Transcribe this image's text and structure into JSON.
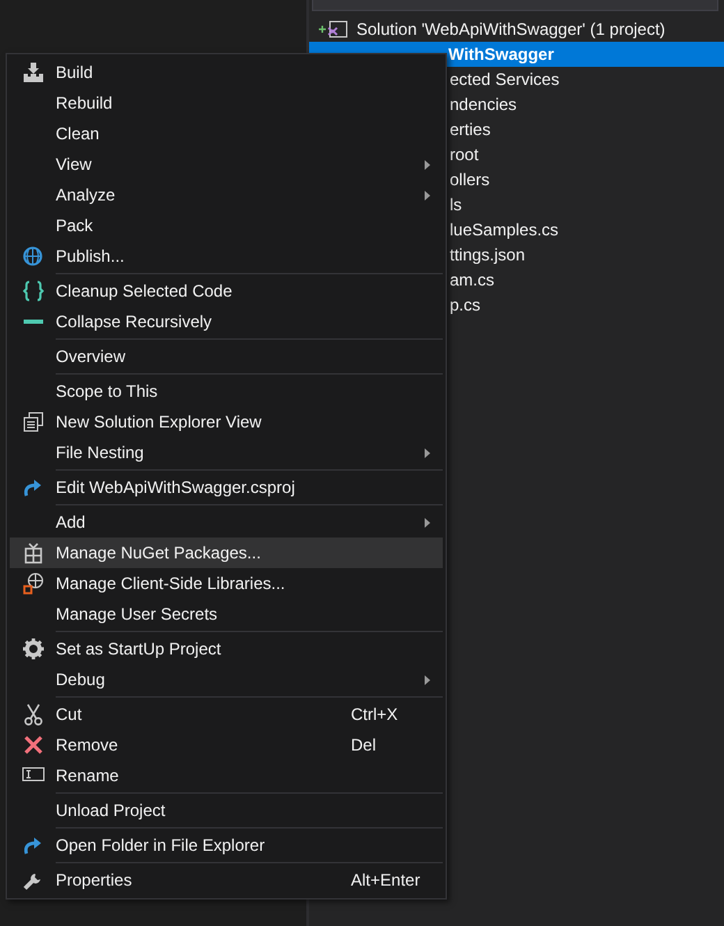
{
  "solution_explorer": {
    "tree": [
      {
        "label": "Solution 'WebApiWithSwagger' (1 project)",
        "kind": "solution",
        "selected": false
      },
      {
        "label": "WithSwagger",
        "kind": "project",
        "selected": true
      },
      {
        "label": "ected Services",
        "kind": "partial",
        "selected": false
      },
      {
        "label": "ndencies",
        "kind": "partial",
        "selected": false
      },
      {
        "label": "erties",
        "kind": "partial",
        "selected": false
      },
      {
        "label": "root",
        "kind": "partial",
        "selected": false
      },
      {
        "label": "ollers",
        "kind": "partial",
        "selected": false
      },
      {
        "label": "ls",
        "kind": "partial",
        "selected": false
      },
      {
        "label": "lueSamples.cs",
        "kind": "partial",
        "selected": false
      },
      {
        "label": "ttings.json",
        "kind": "partial",
        "selected": false
      },
      {
        "label": "am.cs",
        "kind": "partial",
        "selected": false
      },
      {
        "label": "p.cs",
        "kind": "partial",
        "selected": false
      }
    ]
  },
  "context_menu": {
    "groups": [
      [
        {
          "label": "Build",
          "kind": "build",
          "submenu": false,
          "selected": false
        },
        {
          "label": "Rebuild",
          "kind": "plain",
          "submenu": false,
          "selected": false
        },
        {
          "label": "Clean",
          "kind": "plain",
          "submenu": false,
          "selected": false
        },
        {
          "label": "View",
          "kind": "plain",
          "submenu": true,
          "selected": false
        },
        {
          "label": "Analyze",
          "kind": "plain",
          "submenu": true,
          "selected": false
        },
        {
          "label": "Pack",
          "kind": "plain",
          "submenu": false,
          "selected": false
        },
        {
          "label": "Publish...",
          "kind": "publish",
          "submenu": false,
          "selected": false
        }
      ],
      [
        {
          "label": "Cleanup Selected Code",
          "kind": "cleanup",
          "submenu": false,
          "selected": false
        },
        {
          "label": "Collapse Recursively",
          "kind": "collapse",
          "submenu": false,
          "selected": false
        }
      ],
      [
        {
          "label": "Overview",
          "kind": "plain",
          "submenu": false,
          "selected": false
        }
      ],
      [
        {
          "label": "Scope to This",
          "kind": "plain",
          "submenu": false,
          "selected": false
        },
        {
          "label": "New Solution Explorer View",
          "kind": "new-view",
          "submenu": false,
          "selected": false
        },
        {
          "label": "File Nesting",
          "kind": "plain",
          "submenu": true,
          "selected": false
        }
      ],
      [
        {
          "label": "Edit WebApiWithSwagger.csproj",
          "kind": "redo",
          "submenu": false,
          "selected": false
        }
      ],
      [
        {
          "label": "Add",
          "kind": "plain",
          "submenu": true,
          "selected": false
        },
        {
          "label": "Manage NuGet Packages...",
          "kind": "package",
          "submenu": false,
          "selected": true
        },
        {
          "label": "Manage Client-Side Libraries...",
          "kind": "libraries",
          "submenu": false,
          "selected": false
        },
        {
          "label": "Manage User Secrets",
          "kind": "plain",
          "submenu": false,
          "selected": false
        }
      ],
      [
        {
          "label": "Set as StartUp Project",
          "kind": "gear",
          "submenu": false,
          "selected": false
        },
        {
          "label": "Debug",
          "kind": "plain",
          "submenu": true,
          "selected": false
        }
      ],
      [
        {
          "label": "Cut",
          "kind": "cut",
          "shortcut": "Ctrl+X",
          "submenu": false,
          "selected": false
        },
        {
          "label": "Remove",
          "kind": "remove",
          "shortcut": "Del",
          "submenu": false,
          "selected": false
        },
        {
          "label": "Rename",
          "kind": "rename",
          "submenu": false,
          "selected": false
        }
      ],
      [
        {
          "label": "Unload Project",
          "kind": "plain",
          "submenu": false,
          "selected": false
        }
      ],
      [
        {
          "label": "Open Folder in File Explorer",
          "kind": "redo",
          "submenu": false,
          "selected": false
        }
      ],
      [
        {
          "label": "Properties",
          "kind": "wrench",
          "shortcut": "Alt+Enter",
          "submenu": false,
          "selected": false
        }
      ]
    ]
  }
}
